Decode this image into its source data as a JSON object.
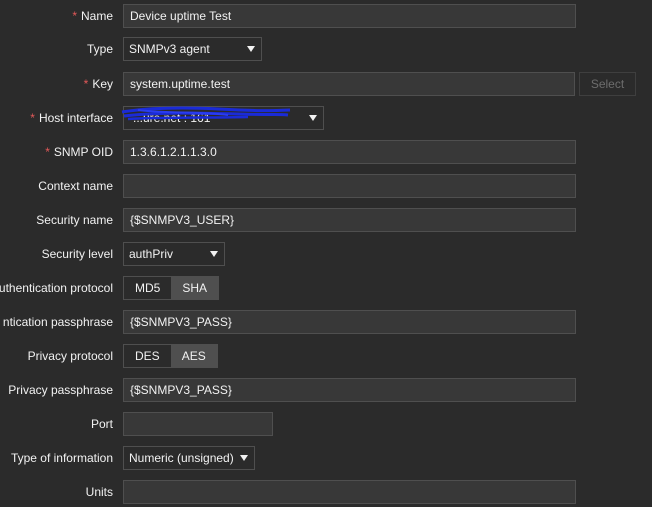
{
  "fields": {
    "name": {
      "label": "Name",
      "required": "*",
      "value": "Device uptime Test"
    },
    "type": {
      "label": "Type",
      "value": "SNMPv3 agent"
    },
    "key": {
      "label": "Key",
      "required": "*",
      "value": "system.uptime.test",
      "select_label": "Select"
    },
    "host_interface": {
      "label": "Host interface",
      "required": "*",
      "value": "...ure.net : 161"
    },
    "snmp_oid": {
      "label": "SNMP OID",
      "required": "*",
      "value": "1.3.6.1.2.1.1.3.0"
    },
    "context_name": {
      "label": "Context name",
      "value": ""
    },
    "security_name": {
      "label": "Security name",
      "value": "{$SNMPV3_USER}"
    },
    "security_level": {
      "label": "Security level",
      "value": "authPriv"
    },
    "auth_protocol": {
      "label": "uthentication protocol",
      "options": [
        "MD5",
        "SHA"
      ],
      "selected": "SHA"
    },
    "auth_passphrase": {
      "label": "ntication passphrase",
      "value": "{$SNMPV3_PASS}"
    },
    "privacy_protocol": {
      "label": "Privacy protocol",
      "options": [
        "DES",
        "AES"
      ],
      "selected": "AES"
    },
    "privacy_passphrase": {
      "label": "Privacy passphrase",
      "value": "{$SNMPV3_PASS}"
    },
    "port": {
      "label": "Port",
      "value": ""
    },
    "type_of_information": {
      "label": "Type of information",
      "value": "Numeric (unsigned)"
    },
    "units": {
      "label": "Units",
      "value": ""
    }
  },
  "colors": {
    "background": "#2b2b2b",
    "input_bg": "#383838",
    "border": "#4f4f4f",
    "required": "#e45959",
    "redaction": "#1a2bd8"
  },
  "icons": {
    "dropdown_arrow": "chevron-down-icon"
  }
}
